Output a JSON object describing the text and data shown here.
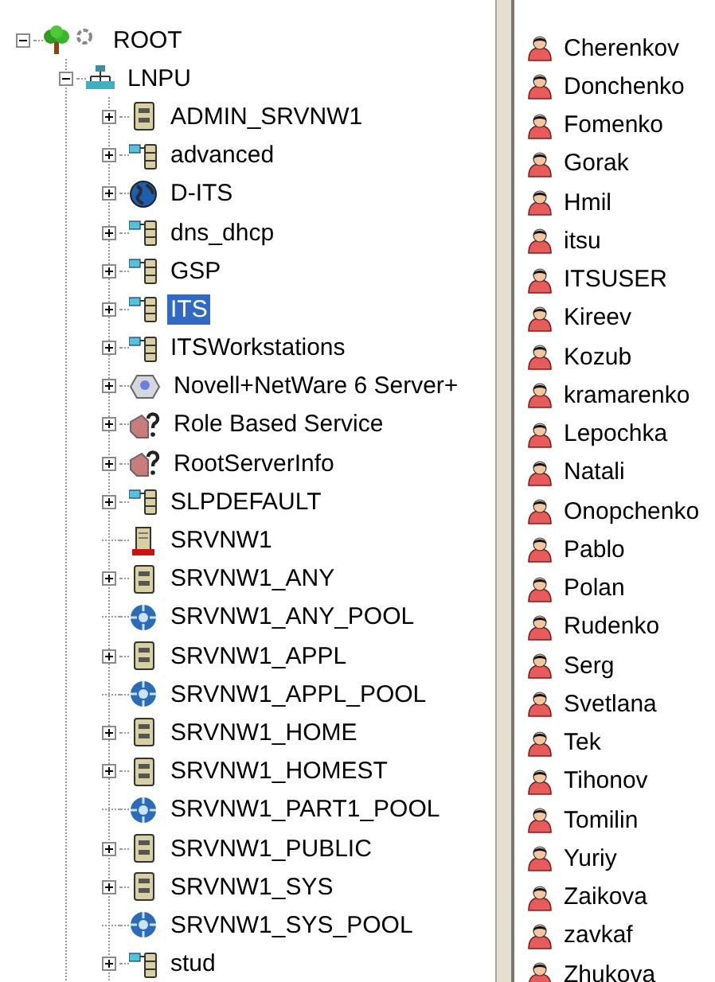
{
  "tree": [
    {
      "label": "ROOT",
      "kind": "root",
      "expanded": true,
      "selected": false,
      "children": [
        {
          "label": "LNPU",
          "kind": "organization",
          "expanded": true,
          "selected": false,
          "children": [
            {
              "label": "ADMIN_SRVNW1",
              "kind": "volume",
              "expanded": false,
              "selected": false
            },
            {
              "label": "advanced",
              "kind": "unit",
              "expanded": false,
              "selected": false
            },
            {
              "label": "D-ITS",
              "kind": "globe",
              "expanded": false,
              "selected": false
            },
            {
              "label": "dns_dhcp",
              "kind": "unit",
              "expanded": false,
              "selected": false
            },
            {
              "label": "GSP",
              "kind": "unit",
              "expanded": false,
              "selected": false
            },
            {
              "label": "ITS",
              "kind": "unit",
              "expanded": false,
              "selected": true
            },
            {
              "label": "ITSWorkstations",
              "kind": "unit",
              "expanded": false,
              "selected": false
            },
            {
              "label": "Novell+NetWare 6 Server+",
              "kind": "product",
              "expanded": false,
              "selected": false
            },
            {
              "label": "Role Based Service",
              "kind": "unknown",
              "expanded": false,
              "selected": false
            },
            {
              "label": "RootServerInfo",
              "kind": "unknown",
              "expanded": false,
              "selected": false
            },
            {
              "label": "SLPDEFAULT",
              "kind": "unit",
              "expanded": false,
              "selected": false
            },
            {
              "label": "SRVNW1",
              "kind": "server",
              "selected": false
            },
            {
              "label": "SRVNW1_ANY",
              "kind": "volume",
              "expanded": false,
              "selected": false
            },
            {
              "label": "SRVNW1_ANY_POOL",
              "kind": "pool",
              "selected": false
            },
            {
              "label": "SRVNW1_APPL",
              "kind": "volume",
              "expanded": false,
              "selected": false
            },
            {
              "label": "SRVNW1_APPL_POOL",
              "kind": "pool",
              "selected": false
            },
            {
              "label": "SRVNW1_HOME",
              "kind": "volume",
              "expanded": false,
              "selected": false
            },
            {
              "label": "SRVNW1_HOMEST",
              "kind": "volume",
              "expanded": false,
              "selected": false
            },
            {
              "label": "SRVNW1_PART1_POOL",
              "kind": "pool",
              "selected": false
            },
            {
              "label": "SRVNW1_PUBLIC",
              "kind": "volume",
              "expanded": false,
              "selected": false
            },
            {
              "label": "SRVNW1_SYS",
              "kind": "volume",
              "expanded": false,
              "selected": false
            },
            {
              "label": "SRVNW1_SYS_POOL",
              "kind": "pool",
              "selected": false
            },
            {
              "label": "stud",
              "kind": "unit",
              "expanded": false,
              "selected": false
            }
          ]
        }
      ]
    }
  ],
  "users": [
    "Cherenkov",
    "Donchenko",
    "Fomenko",
    "Gorak",
    "Hmil",
    "itsu",
    "ITSUSER",
    "Kireev",
    "Kozub",
    "kramarenko",
    "Lepochka",
    "Natali",
    "Onopchenko",
    "Pablo",
    "Polan",
    "Rudenko",
    "Serg",
    "Svetlana",
    "Tek",
    "Tihonov",
    "Tomilin",
    "Yuriy",
    "Zaikova",
    "zavkaf",
    "Zhukova"
  ]
}
